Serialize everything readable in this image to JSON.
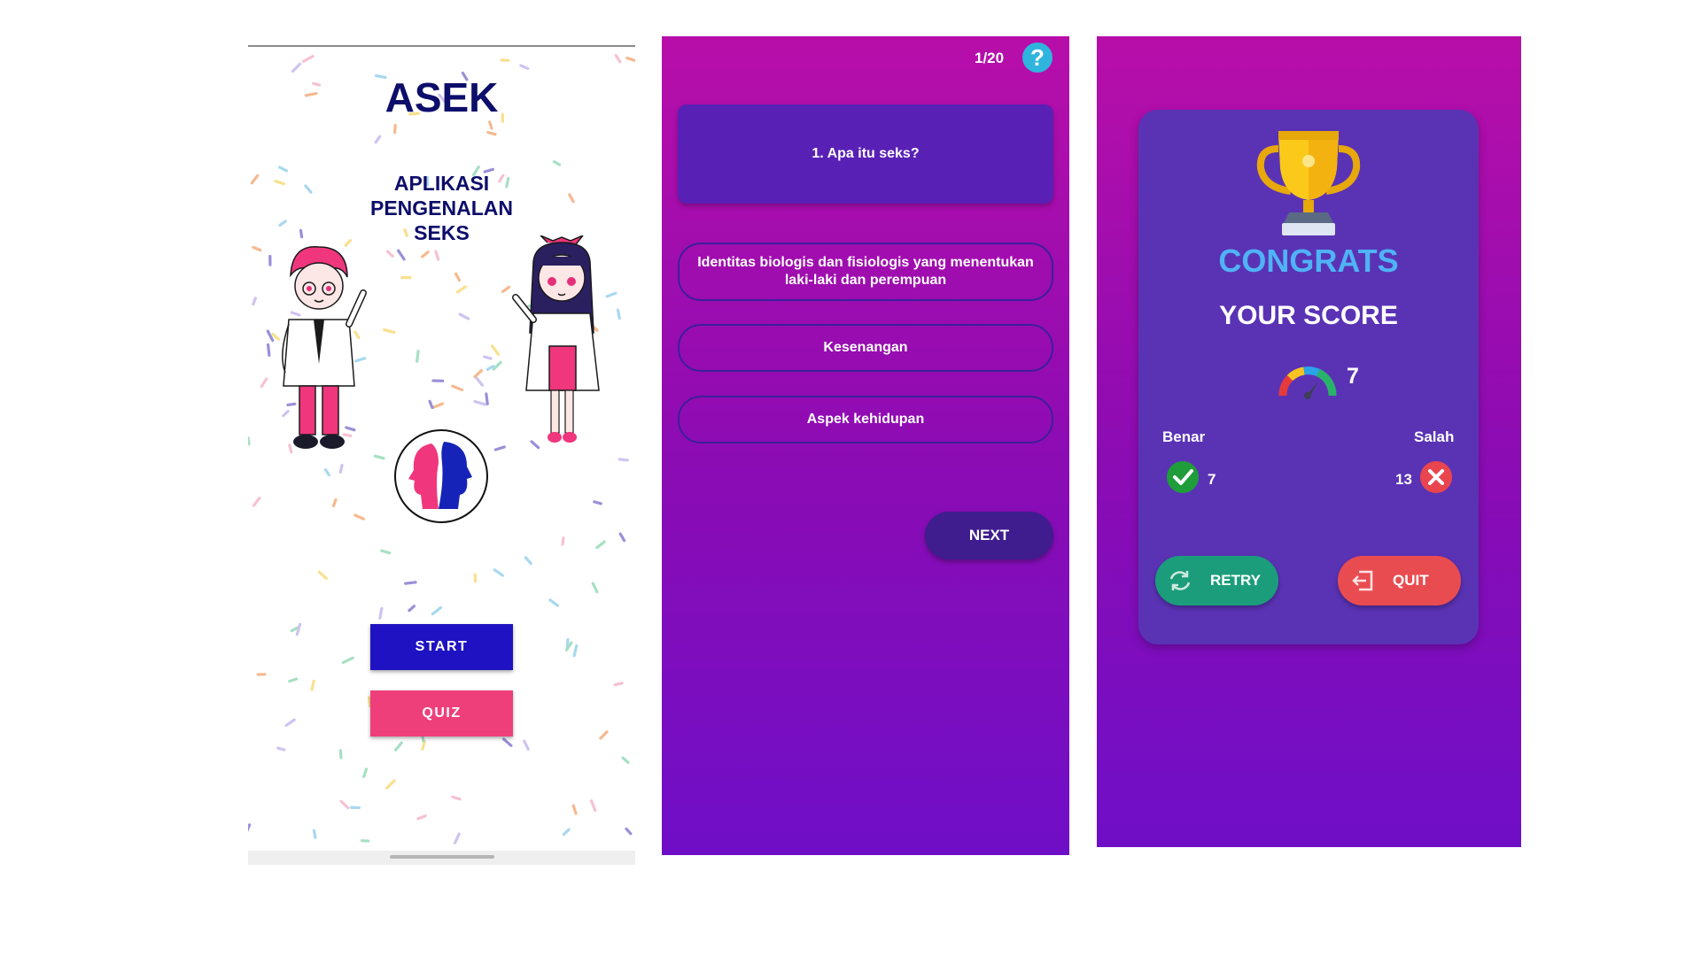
{
  "home": {
    "title": "ASEK",
    "subtitle": "APLIKASI\nPENGENALAN\nSEKS",
    "start_label": "START",
    "quiz_label": "QUIZ",
    "colors": {
      "title": "#0d0d6b",
      "start": "#1f12c2",
      "quiz": "#ef3f7b"
    }
  },
  "quiz": {
    "counter": "1/20",
    "help_icon": "?",
    "question": "1. Apa itu seks?",
    "options": [
      {
        "label": "Identitas biologis dan fisiologis yang menentukan laki-laki dan perempuan"
      },
      {
        "label": "Kesenangan"
      },
      {
        "label": "Aspek kehidupan"
      }
    ],
    "next_label": "NEXT"
  },
  "result": {
    "congrats": "CONGRATS",
    "your_score_label": "YOUR SCORE",
    "score": "7",
    "benar_label": "Benar",
    "salah_label": "Salah",
    "benar_value": "7",
    "salah_value": "13",
    "retry_label": "RETRY",
    "quit_label": "QUIT",
    "colors": {
      "retry": "#1b9d7b",
      "quit": "#e84c51",
      "congrats": "#4fb3f5"
    }
  }
}
